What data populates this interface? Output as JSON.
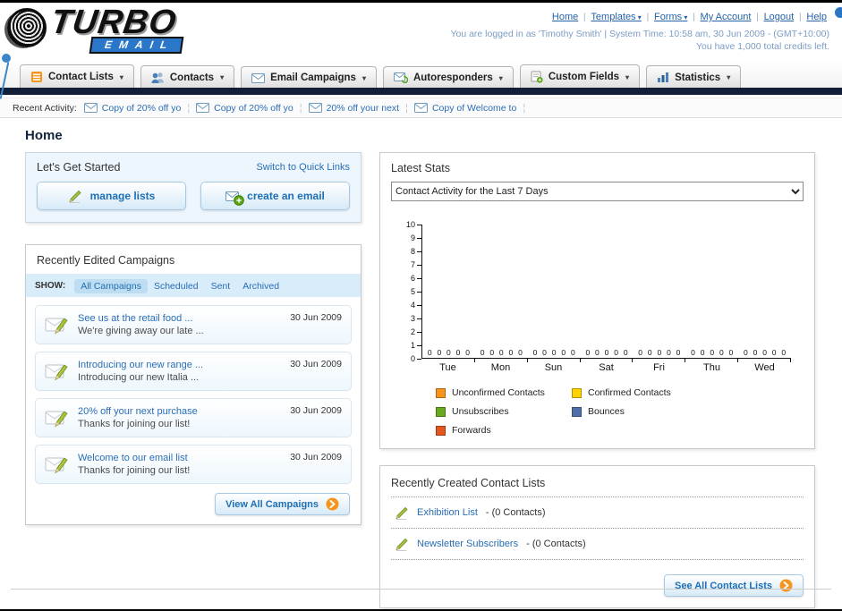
{
  "page": {
    "title": "Home"
  },
  "header": {
    "logo": {
      "title": "TURBO",
      "subtitle": "EMAIL"
    },
    "top_links": [
      {
        "label": "Home",
        "dropdown": false
      },
      {
        "label": "Templates",
        "dropdown": true
      },
      {
        "label": "Forms",
        "dropdown": true
      },
      {
        "label": "My Account",
        "dropdown": false
      },
      {
        "label": "Logout",
        "dropdown": false
      },
      {
        "label": "Help",
        "dropdown": false
      }
    ],
    "login_line": "You are logged in as 'Timothy Smith' | System Time: 10:58 am, 30 Jun 2009 - (GMT+10:00)",
    "credits_line": "You have 1,000 total credits left."
  },
  "nav": {
    "tabs": [
      {
        "label": "Contact Lists",
        "icon": "list-icon"
      },
      {
        "label": "Contacts",
        "icon": "people-icon"
      },
      {
        "label": "Email Campaigns",
        "icon": "envelope-icon"
      },
      {
        "label": "Autoresponders",
        "icon": "autoresponder-icon"
      },
      {
        "label": "Custom Fields",
        "icon": "form-plus-icon"
      },
      {
        "label": "Statistics",
        "icon": "chart-icon"
      }
    ]
  },
  "recent_activity": {
    "label": "Recent Activity:",
    "separator": "¦",
    "items": [
      "Copy of 20% off yo",
      "Copy of 20% off yo",
      "20% off your next",
      "Copy of Welcome to"
    ]
  },
  "get_started": {
    "title": "Let's Get Started",
    "switch_link": "Switch to Quick Links",
    "manage_label": "manage lists",
    "create_label": "create an email"
  },
  "campaigns": {
    "title": "Recently Edited Campaigns",
    "show_label": "SHOW:",
    "tabs": [
      "All Campaigns",
      "Scheduled",
      "Sent",
      "Archived"
    ],
    "selected_tab": 0,
    "items": [
      {
        "title": "See us at the retail food ...",
        "subtitle": "We're giving away our late ...",
        "date": "30 Jun 2009"
      },
      {
        "title": "Introducing our new range ...",
        "subtitle": "Introducing our new Italia ...",
        "date": "30 Jun 2009"
      },
      {
        "title": "20% off your next purchase",
        "subtitle": "Thanks for joining our list!",
        "date": "30 Jun 2009"
      },
      {
        "title": "Welcome to our email list",
        "subtitle": "Thanks for joining our list!",
        "date": "30 Jun 2009"
      }
    ],
    "view_all_label": "View All Campaigns"
  },
  "stats": {
    "title": "Latest Stats",
    "dropdown_value": "Contact Activity for the Last 7 Days"
  },
  "chart_data": {
    "type": "bar",
    "title": "Contact Activity for the Last 7 Days",
    "categories": [
      "Tue",
      "Mon",
      "Sun",
      "Sat",
      "Fri",
      "Thu",
      "Wed"
    ],
    "series": [
      {
        "name": "Unconfirmed Contacts",
        "color": "#f7941d",
        "values": [
          0,
          0,
          0,
          0,
          0,
          0,
          0
        ]
      },
      {
        "name": "Confirmed Contacts",
        "color": "#ffd200",
        "values": [
          0,
          0,
          0,
          0,
          0,
          0,
          0
        ]
      },
      {
        "name": "Unsubscribes",
        "color": "#69a821",
        "values": [
          0,
          0,
          0,
          0,
          0,
          0,
          0
        ]
      },
      {
        "name": "Bounces",
        "color": "#4f6fa8",
        "values": [
          0,
          0,
          0,
          0,
          0,
          0,
          0
        ]
      },
      {
        "name": "Forwards",
        "color": "#e2571f",
        "values": [
          0,
          0,
          0,
          0,
          0,
          0,
          0
        ]
      }
    ],
    "ylim": [
      0,
      10
    ],
    "ytick_step": 1,
    "grid": false,
    "legend_position": "bottom"
  },
  "contact_lists": {
    "title": "Recently Created Contact Lists",
    "items": [
      {
        "link": "Exhibition List",
        "suffix": " - (0 Contacts)"
      },
      {
        "link": "Newsletter Subscribers",
        "suffix": " - (0 Contacts)"
      }
    ],
    "see_all_label": "See All Contact Lists"
  }
}
